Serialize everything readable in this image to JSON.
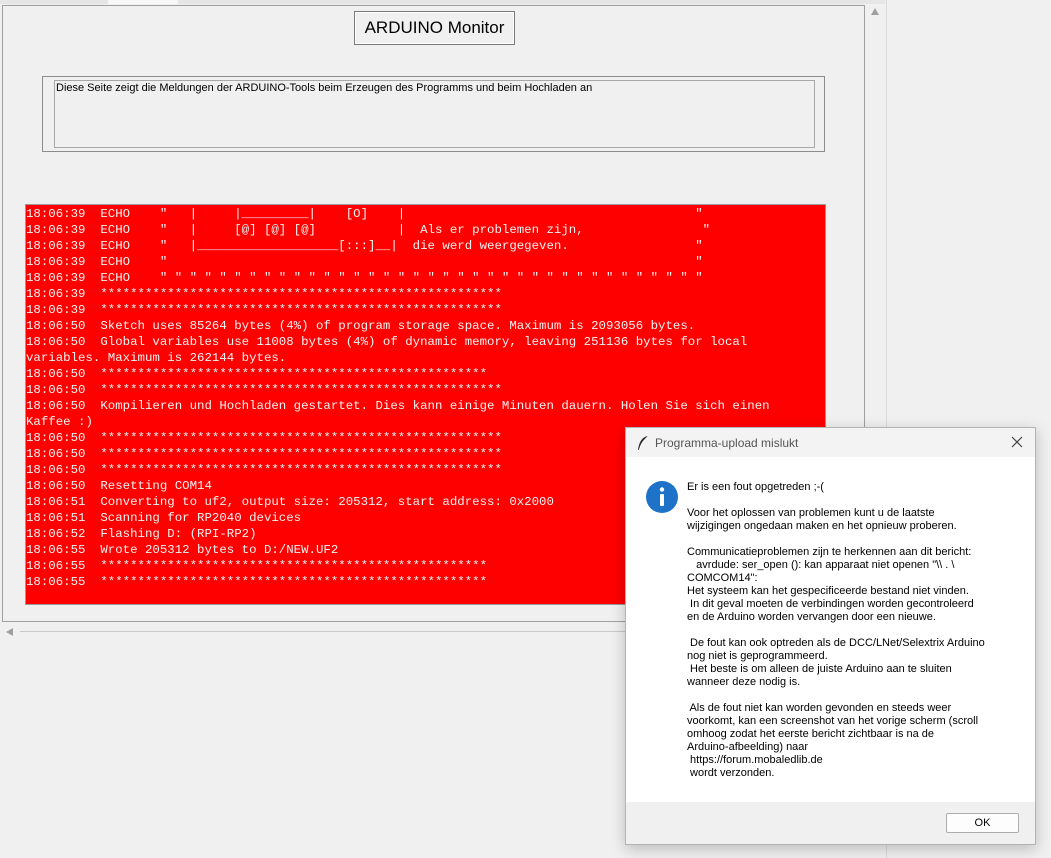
{
  "app": {
    "title_button": "ARDUINO Monitor",
    "description": "Diese Seite zeigt die Meldungen der ARDUINO-Tools beim Erzeugen des Programms und beim Hochladen an"
  },
  "log": {
    "lines": [
      "18:06:39  ECHO    \"   |     |_________|    [O]    |                                       \"",
      "18:06:39  ECHO    \"   |     [@] [@] [@]           |  Als er problemen zijn,                \"",
      "18:06:39  ECHO    \"   |___________________[:::]__|  die werd weergegeven.                 \"",
      "18:06:39  ECHO    \"                                                                       \"",
      "18:06:39  ECHO    \" \" \" \" \" \" \" \" \" \" \" \" \" \" \" \" \" \" \" \" \" \" \" \" \" \" \" \" \" \" \" \" \" \" \" \" \"",
      "18:06:39  ******************************************************",
      "18:06:39  ******************************************************",
      "18:06:50  Sketch uses 85264 bytes (4%) of program storage space. Maximum is 2093056 bytes.",
      "18:06:50  Global variables use 11008 bytes (4%) of dynamic memory, leaving 251136 bytes for local",
      "variables. Maximum is 262144 bytes.",
      "18:06:50  ****************************************************",
      "18:06:50  ******************************************************",
      "18:06:50  Kompilieren und Hochladen gestartet. Dies kann einige Minuten dauern. Holen Sie sich einen",
      "Kaffee :)",
      "18:06:50  ******************************************************",
      "18:06:50  ******************************************************",
      "18:06:50  ******************************************************",
      "18:06:50  Resetting COM14",
      "18:06:51  Converting to uf2, output size: 205312, start address: 0x2000",
      "18:06:51  Scanning for RP2040 devices",
      "18:06:52  Flashing D: (RPI-RP2)",
      "18:06:55  Wrote 205312 bytes to D:/NEW.UF2",
      "18:06:55  ****************************************************",
      "18:06:55  ****************************************************"
    ]
  },
  "dialog": {
    "title": "Programma-upload mislukt",
    "message_lines": [
      "Er is een fout opgetreden ;-(",
      "",
      "Voor het oplossen van problemen kunt u de laatste",
      "wijzigingen ongedaan maken en het opnieuw proberen.",
      "",
      "Communicatieproblemen zijn te herkennen aan dit bericht:",
      "   avrdude: ser_open (): kan apparaat niet openen \"\\\\ . \\",
      "COMCOM14\":",
      "Het systeem kan het gespecificeerde bestand niet vinden.",
      " In dit geval moeten de verbindingen worden gecontroleerd",
      "en de Arduino worden vervangen door een nieuwe.",
      "",
      " De fout kan ook optreden als de DCC/LNet/Selextrix Arduino",
      "nog niet is geprogrammeerd.",
      " Het beste is om alleen de juiste Arduino aan te sluiten",
      "wanneer deze nodig is.",
      "",
      " Als de fout niet kan worden gevonden en steeds weer",
      "voorkomt, kan een screenshot van het vorige scherm (scroll",
      "omhoog zodat het eerste bericht zichtbaar is na de",
      "Arduino-afbeelding) naar",
      " https://forum.mobaledlib.de",
      " wordt verzonden."
    ],
    "ok_label": "OK"
  },
  "icons": {
    "titlebar": "feather-icon",
    "close": "close-icon",
    "message": "info-icon",
    "scroll_up": "arrow-up-icon",
    "scroll_left": "arrow-left-icon"
  },
  "colors": {
    "log_background": "#ff0000",
    "log_text": "#f2f2f2",
    "info_icon": "#1e73c8"
  }
}
